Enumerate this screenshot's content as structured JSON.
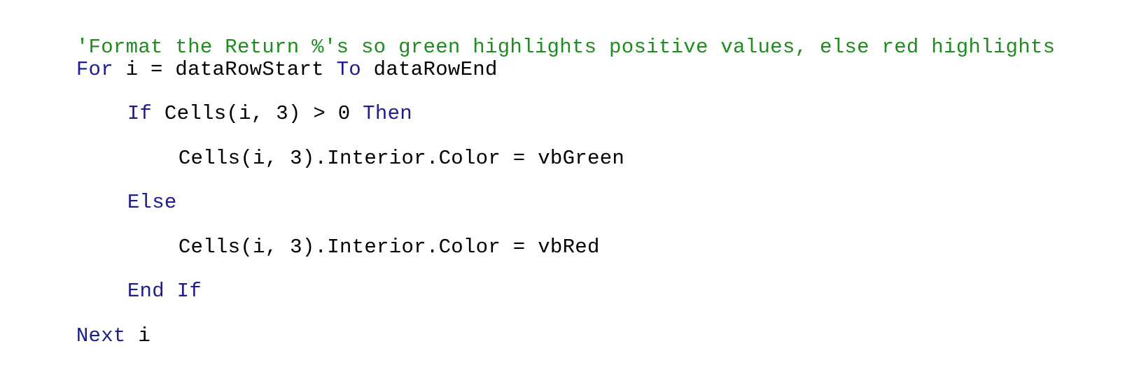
{
  "colors": {
    "comment": "#1f8c1f",
    "keyword": "#1d1d8f",
    "plain": "#000000",
    "background": "#ffffff"
  },
  "code": {
    "line1": {
      "comment": "'Format the Return %'s so green highlights positive values, else red highlights"
    },
    "line2": {
      "kw_for": "For",
      "rest": " i = dataRowStart ",
      "kw_to": "To",
      "rest2": " dataRowEnd"
    },
    "line3": {
      "kw_if": "If",
      "cond": " Cells(i, 3) > 0 ",
      "kw_then": "Then"
    },
    "line4": {
      "stmt": "Cells(i, 3).Interior.Color = vbGreen"
    },
    "line5": {
      "kw_else": "Else"
    },
    "line6": {
      "stmt": "Cells(i, 3).Interior.Color = vbRed"
    },
    "line7": {
      "kw_end_if": "End If"
    },
    "line8": {
      "kw_next": "Next",
      "var": " i"
    }
  }
}
